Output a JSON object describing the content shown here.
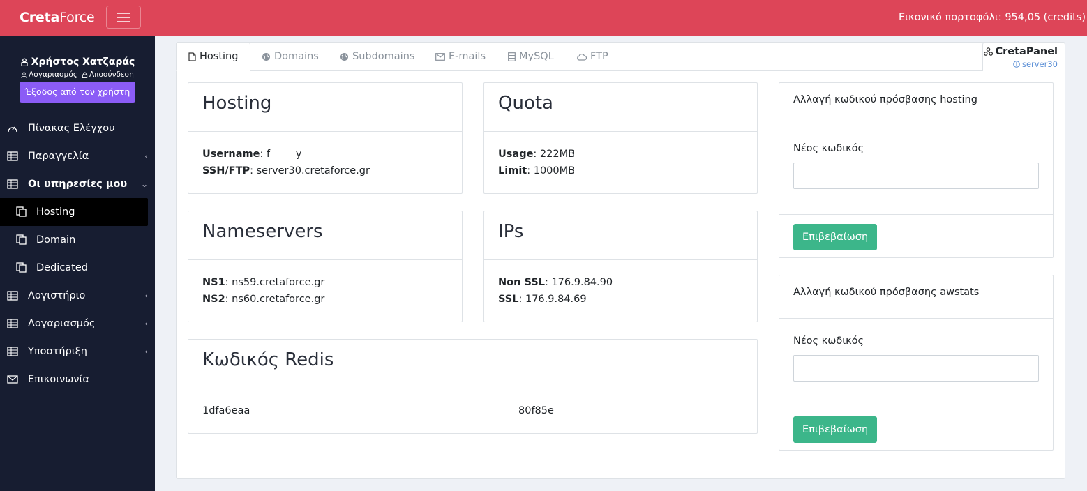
{
  "topbar": {
    "brand_bold": "Creta",
    "brand_light": "Force",
    "wallet": "Εικονικό πορτοφόλι: 954,05 (credits)"
  },
  "sidebar": {
    "user_name": "Χρήστος Χατζαράς",
    "account_link": "Λογαριασμός",
    "logout_link": "Αποσύνδεση",
    "exit_button": "Έξοδος από τον χρήστη",
    "items": [
      {
        "label": "Πίνακας Ελέγχου",
        "icon": "dashboard-icon"
      },
      {
        "label": "Παραγγελία",
        "icon": "table-icon"
      },
      {
        "label": "Οι υπηρεσίες μου",
        "icon": "table-icon"
      },
      {
        "label": "Hosting",
        "icon": "copy-icon"
      },
      {
        "label": "Domain",
        "icon": "copy-icon"
      },
      {
        "label": "Dedicated",
        "icon": "copy-icon"
      },
      {
        "label": "Λογιστήριο",
        "icon": "table-icon"
      },
      {
        "label": "Λογαριασμός",
        "icon": "table-icon"
      },
      {
        "label": "Υποστήριξη",
        "icon": "table-icon"
      },
      {
        "label": "Επικοινωνία",
        "icon": "mail-icon"
      }
    ]
  },
  "tabs": [
    {
      "label": "Hosting",
      "icon": "file-icon",
      "active": true
    },
    {
      "label": "Domains",
      "icon": "globe-icon"
    },
    {
      "label": "Subdomains",
      "icon": "globe-icon"
    },
    {
      "label": "E-mails",
      "icon": "mail-icon"
    },
    {
      "label": "MySQL",
      "icon": "database-icon"
    },
    {
      "label": "FTP",
      "icon": "cloud-icon"
    }
  ],
  "cpanel": {
    "title": "CretaPanel",
    "server": "server30"
  },
  "hosting": {
    "title": "Hosting",
    "username_label": "Username",
    "username_value": ": f        y",
    "ssh_label": "SSH/FTP",
    "ssh_value": ": server30.cretaforce.gr"
  },
  "quota": {
    "title": "Quota",
    "usage_label": "Usage",
    "usage_value": ": 222MB",
    "limit_label": "Limit",
    "limit_value": ": 1000MB"
  },
  "nameservers": {
    "title": "Nameservers",
    "ns1_label": "NS1",
    "ns1_value": ": ns59.cretaforce.gr",
    "ns2_label": "NS2",
    "ns2_value": ": ns60.cretaforce.gr"
  },
  "ips": {
    "title": "IPs",
    "nonssl_label": "Non SSL",
    "nonssl_value": ": 176.9.84.90",
    "ssl_label": "SSL",
    "ssl_value": ": 176.9.84.69"
  },
  "redis": {
    "title": "Κωδικός Redis",
    "value_start": "1dfa6eaa",
    "value_end": "80f85e"
  },
  "hosting_password": {
    "title": "Αλλαγή κωδικού πρόσβασης hosting",
    "label": "Νέος κωδικός",
    "button": "Επιβεβαίωση"
  },
  "awstats_password": {
    "title": "Αλλαγή κωδικού πρόσβασης awstats",
    "label": "Νέος κωδικός",
    "button": "Επιβεβαίωση"
  }
}
